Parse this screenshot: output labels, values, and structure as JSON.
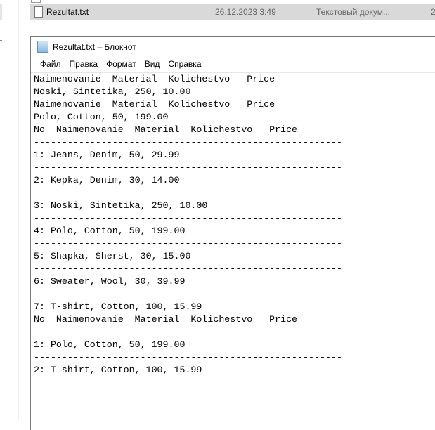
{
  "explorer": {
    "file": {
      "name": "Rezultat.txt",
      "date": "26.12.2023 3:49",
      "type": "Текстовый докум...",
      "size": "2"
    }
  },
  "notepad": {
    "title": "Rezultat.txt – Блокнот",
    "menu": [
      "Файл",
      "Правка",
      "Формат",
      "Вид",
      "Справка"
    ],
    "lines": [
      "Naimenovanie  Material  Kolichestvo   Price",
      "Noski, Sintetika, 250, 10.00",
      "Naimenovanie  Material  Kolichestvo   Price",
      "Polo, Cotton, 50, 199.00",
      "No  Naimenovanie  Material  Kolichestvo   Price",
      "-------------------------------------------------------",
      "1: Jeans, Denim, 50, 29.99",
      "-------------------------------------------------------",
      "2: Kepka, Denim, 30, 14.00",
      "-------------------------------------------------------",
      "3: Noski, Sintetika, 250, 10.00",
      "-------------------------------------------------------",
      "4: Polo, Cotton, 50, 199.00",
      "-------------------------------------------------------",
      "5: Shapka, Sherst, 30, 15.00",
      "-------------------------------------------------------",
      "6: Sweater, Wool, 30, 39.99",
      "-------------------------------------------------------",
      "7: T-shirt, Cotton, 100, 15.99",
      "No  Naimenovanie  Material  Kolichestvo   Price",
      "-------------------------------------------------------",
      "1: Polo, Cotton, 50, 199.00",
      "-------------------------------------------------------",
      "2: T-shirt, Cotton, 100, 15.99"
    ]
  }
}
